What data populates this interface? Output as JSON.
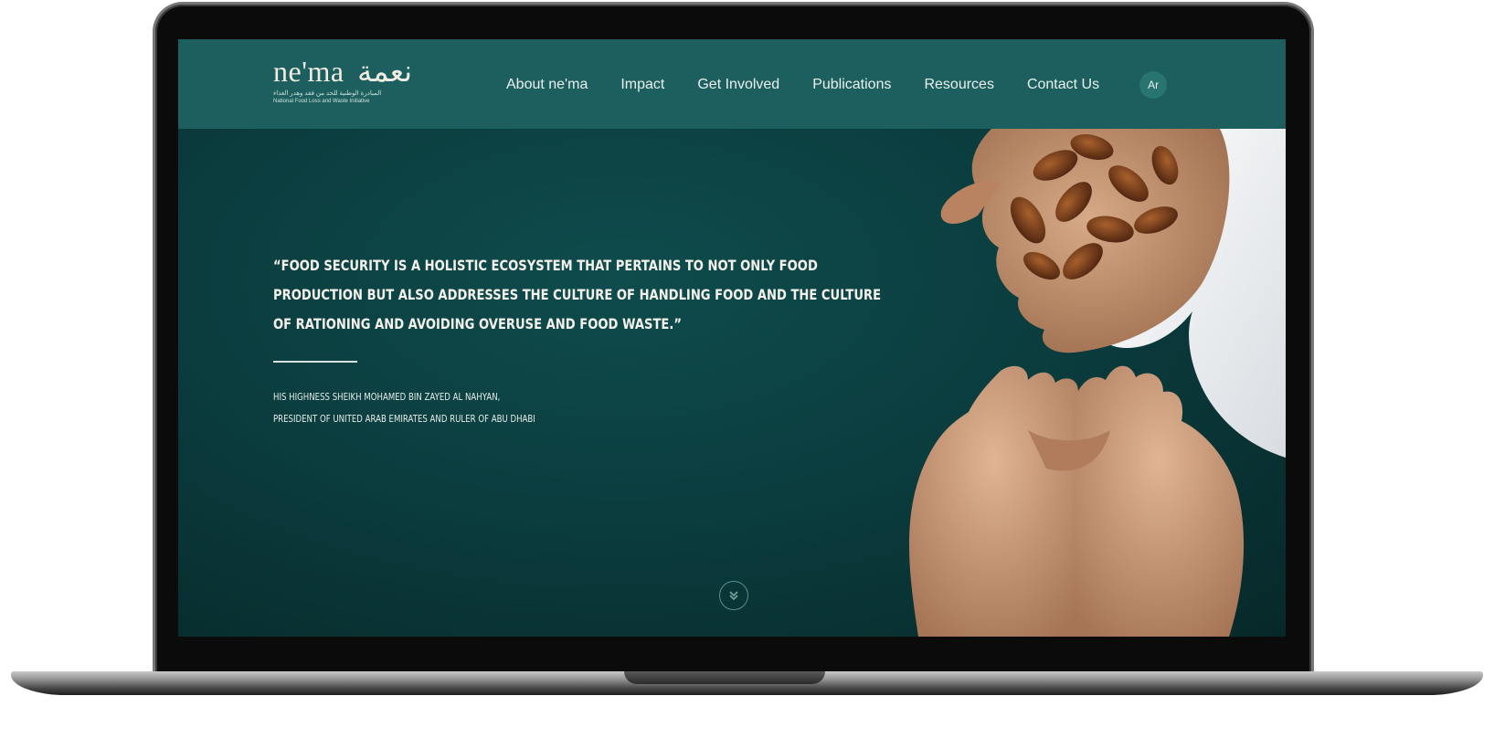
{
  "logo": {
    "latin": "ne'ma",
    "arabic": "نعمة",
    "arabic_subtitle": "المبادرة الوطنية للحد من فقد وهدر الغذاء",
    "english_subtitle": "National Food Loss and Waste Initiative"
  },
  "nav": {
    "items": [
      {
        "label": "About ne'ma"
      },
      {
        "label": "Impact"
      },
      {
        "label": "Get Involved"
      },
      {
        "label": "Publications"
      },
      {
        "label": "Resources"
      },
      {
        "label": "Contact Us"
      }
    ],
    "language_toggle": "Ar"
  },
  "hero": {
    "quote": "“Food security is a holistic ecosystem that pertains to not only food production but also addresses the culture of handling food and the culture of rationing and avoiding overuse and food waste.”",
    "attribution_line1": "His Highness Sheikh Mohamed bin Zayed Al Nahyan,",
    "attribution_line2": "President of United Arab Emirates and Ruler of Abu Dhabi",
    "scroll_icon": "double-chevron-down-icon"
  },
  "colors": {
    "header_bg": "#1c5f5e",
    "hero_bg": "#0b3d3f",
    "text_light": "#f4f1ea"
  }
}
